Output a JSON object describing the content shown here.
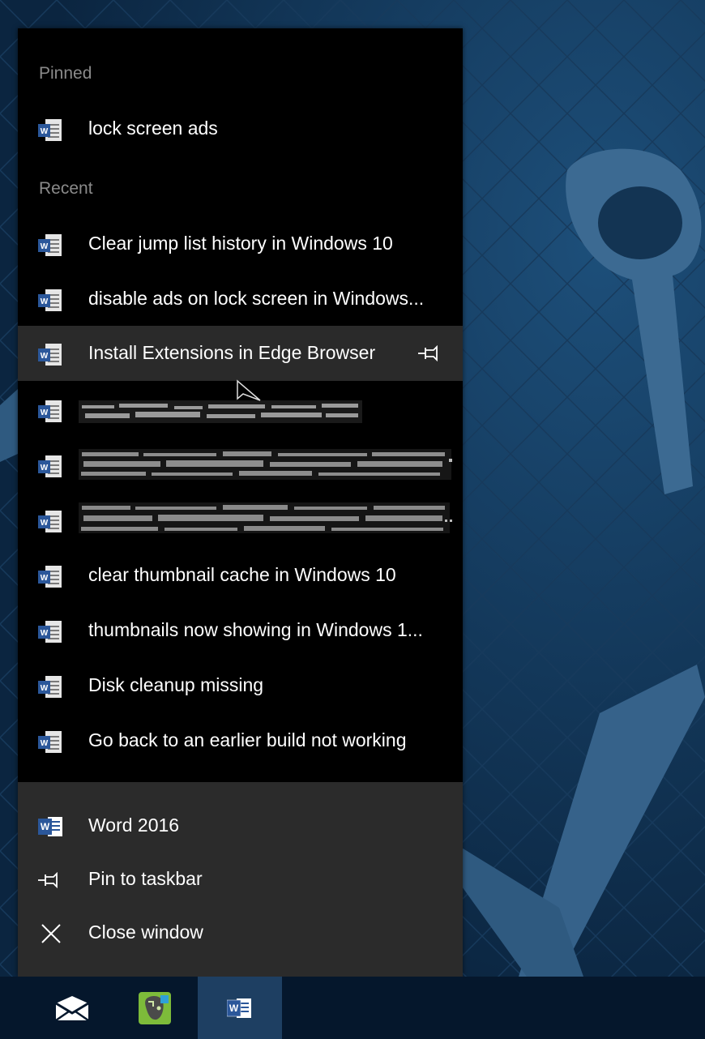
{
  "jumplist": {
    "pinned_header": "Pinned",
    "pinned_items": [
      {
        "label": "lock screen ads",
        "icon": "word-document-icon"
      }
    ],
    "recent_header": "Recent",
    "recent_items": [
      {
        "label": "Clear jump list history in Windows 10",
        "icon": "word-document-icon"
      },
      {
        "label": "disable ads on lock screen in Windows...",
        "icon": "word-document-icon"
      },
      {
        "label": "Install Extensions in Edge Browser",
        "icon": "word-document-icon",
        "hover": true
      },
      {
        "label": "",
        "icon": "word-document-icon",
        "garbled": true
      },
      {
        "label": "",
        "icon": "word-document-icon",
        "garbled": true
      },
      {
        "label": "",
        "icon": "word-document-icon",
        "garbled": true
      },
      {
        "label": "clear thumbnail cache in Windows 10",
        "icon": "word-document-icon"
      },
      {
        "label": "thumbnails now showing in Windows 1...",
        "icon": "word-document-icon"
      },
      {
        "label": "Disk cleanup missing",
        "icon": "word-document-icon"
      },
      {
        "label": "Go back to an earlier build not working",
        "icon": "word-document-icon"
      }
    ],
    "tasks": [
      {
        "label": "Word 2016",
        "icon": "word-app-icon"
      },
      {
        "label": "Pin to taskbar",
        "icon": "pin-icon"
      },
      {
        "label": "Close window",
        "icon": "close-icon"
      }
    ]
  },
  "taskbar": {
    "apps": [
      {
        "name": "mail",
        "icon": "mail-icon"
      },
      {
        "name": "evernote",
        "icon": "evernote-icon"
      },
      {
        "name": "word",
        "icon": "word-app-icon",
        "active": true
      }
    ]
  },
  "colors": {
    "jumplist_bg": "#000000",
    "tasks_bg": "#2b2b2b",
    "hover_bg": "#2a2a2a",
    "header_text": "#8a8a8a",
    "word_blue": "#2b579a",
    "desktop_bg": "#0d2a46",
    "taskbar_bg": "#05172c"
  }
}
